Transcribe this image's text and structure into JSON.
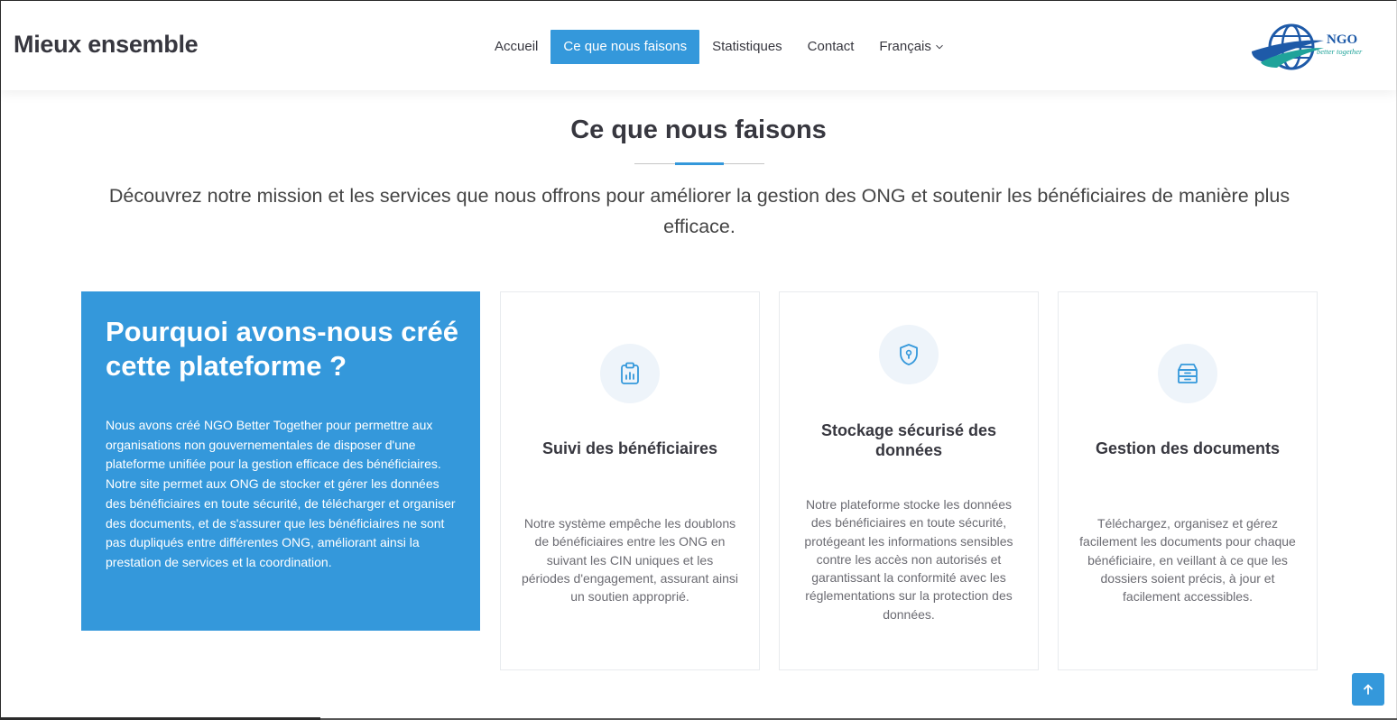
{
  "header": {
    "brand": "Mieux ensemble",
    "nav": {
      "home": "Accueil",
      "what_we_do": "Ce que nous faisons",
      "stats": "Statistiques",
      "contact": "Contact",
      "language": "Français"
    },
    "logo": {
      "main": "NGO",
      "sub": "better together"
    }
  },
  "section": {
    "title": "Ce que nous faisons",
    "intro": "Découvrez notre mission et les services que nous offrons pour améliorer la gestion des ONG et soutenir les bénéficiaires de manière plus efficace."
  },
  "why": {
    "title": "Pourquoi avons-nous créé cette plateforme ?",
    "text": "Nous avons créé NGO Better Together pour permettre aux organisations non gouvernementales de disposer d'une plateforme unifiée pour la gestion efficace des bénéficiaires. Notre site permet aux ONG de stocker et gérer les données des bénéficiaires en toute sécurité, de télécharger et organiser des documents, et de s'assurer que les bénéficiaires ne sont pas dupliqués entre différentes ONG, améliorant ainsi la prestation de services et la coordination."
  },
  "cards": [
    {
      "icon": "clipboard-chart-icon",
      "title": "Suivi des bénéficiaires",
      "text": "Notre système empêche les doublons de bénéficiaires entre les ONG en suivant les CIN uniques et les périodes d'engagement, assurant ainsi un soutien approprié."
    },
    {
      "icon": "shield-lock-icon",
      "title": "Stockage sécurisé des données",
      "text": "Notre plateforme stocke les données des bénéficiaires en toute sécurité, protégeant les informations sensibles contre les accès non autorisés et garantissant la conformité avec les réglementations sur la protection des données."
    },
    {
      "icon": "archive-box-icon",
      "title": "Gestion des documents",
      "text": "Téléchargez, organisez et gérez facilement les documents pour chaque bénéficiaire, en veillant à ce que les dossiers soient précis, à jour et facilement accessibles."
    }
  ],
  "colors": {
    "accent": "#3498db",
    "text": "#37373f",
    "muted": "#6b6b72",
    "icon_bg": "#eef4fa"
  }
}
